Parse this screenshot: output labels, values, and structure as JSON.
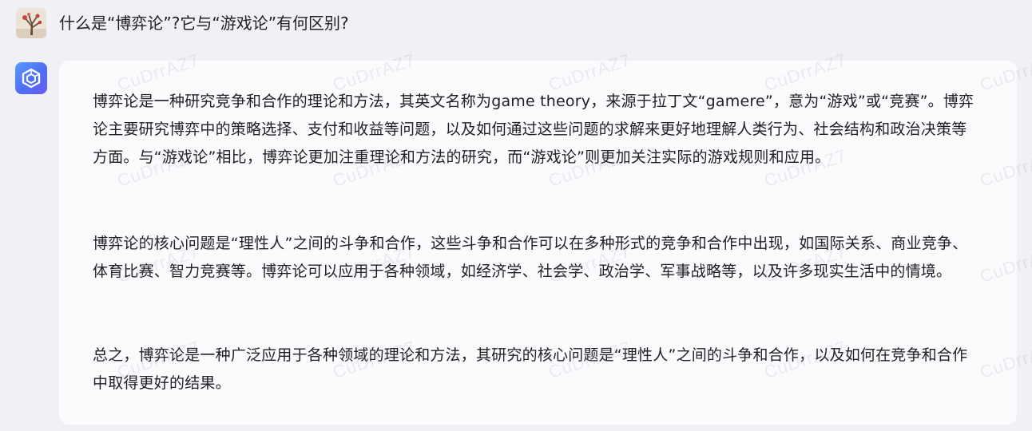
{
  "user": {
    "avatar_icon": "user-avatar-photo",
    "question": "什么是“博弈论”?它与“游戏论”有何区别?"
  },
  "assistant": {
    "avatar_icon": "bot-cube-icon",
    "accent_color": "#4d6df5",
    "paragraphs": [
      "博弈论是一种研究竞争和合作的理论和方法，其英文名称为game theory，来源于拉丁文“gamere”，意为“游戏”或“竞赛”。博弈论主要研究博弈中的策略选择、支付和收益等问题，以及如何通过这些问题的求解来更好地理解人类行为、社会结构和政治决策等方面。与“游戏论”相比，博弈论更加注重理论和方法的研究，而“游戏论”则更加关注实际的游戏规则和应用。",
      "博弈论的核心问题是“理性人”之间的斗争和合作，这些斗争和合作可以在多种形式的竞争和合作中出现，如国际关系、商业竞争、体育比赛、智力竞赛等。博弈论可以应用于各种领域，如经济学、社会学、政治学、军事战略等，以及许多现实生活中的情境。",
      "总之，博弈论是一种广泛应用于各种领域的理论和方法，其研究的核心问题是“理性人”之间的斗争和合作，以及如何在竞争和合作中取得更好的结果。"
    ]
  },
  "watermark": {
    "text": "CuDrrAZ7"
  },
  "colors": {
    "page_background": "#f0f1f6",
    "card_background": "#fbfbfd",
    "text": "#1f1f24"
  }
}
